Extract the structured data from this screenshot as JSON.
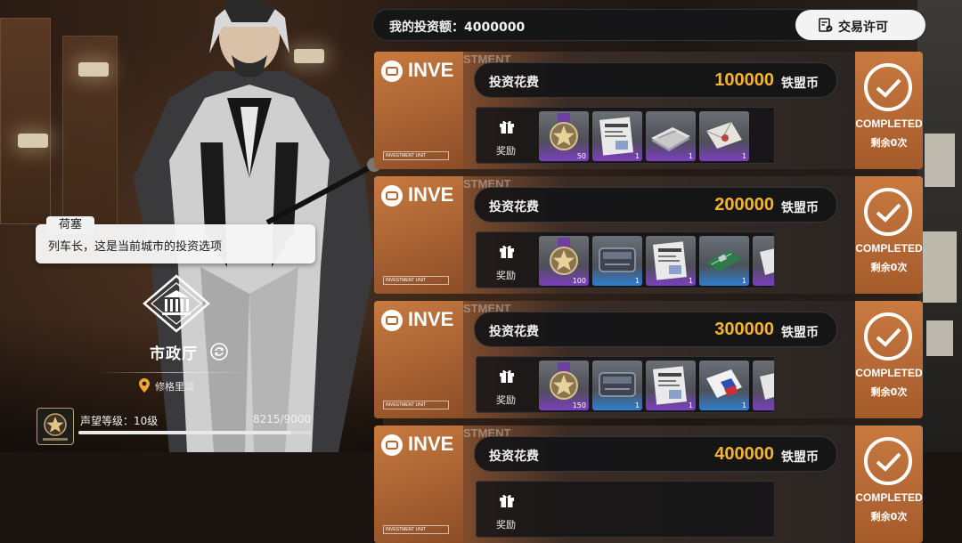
{
  "header": {
    "investment_label": "我的投资额：4000000",
    "license_button": "交易许可"
  },
  "dialogue": {
    "speaker": "荷塞",
    "text": "列车长，这是当前城市的投资选项"
  },
  "building": {
    "name": "市政厅",
    "location": "修格里城"
  },
  "reputation": {
    "label": "声望等级：10级",
    "value": "8215/9000",
    "progress": 0.913
  },
  "card_common": {
    "brand": "INVE",
    "brand_tail": "STMENT",
    "unit_tag": "INVESTMENT UNIT",
    "cost_label": "投资花费",
    "currency": "铁盟币",
    "reward_label": "奖励",
    "status": "COMPLETED",
    "remaining": "剩余0次"
  },
  "cards": [
    {
      "cost": "100000",
      "rewards": [
        {
          "icon": "star-medal-icon",
          "count": "50",
          "rarity": "purple"
        },
        {
          "icon": "document-icon",
          "count": "1",
          "rarity": "purple"
        },
        {
          "icon": "paper-stack-icon",
          "count": "1",
          "rarity": "purple"
        },
        {
          "icon": "envelope-icon",
          "count": "1",
          "rarity": "purple"
        }
      ]
    },
    {
      "cost": "200000",
      "rewards": [
        {
          "icon": "star-medal-icon",
          "count": "100",
          "rarity": "purple"
        },
        {
          "icon": "machine-part-icon",
          "count": "1",
          "rarity": "blue"
        },
        {
          "icon": "document-icon",
          "count": "1",
          "rarity": "purple"
        },
        {
          "icon": "circuit-board-icon",
          "count": "1",
          "rarity": "blue"
        },
        {
          "icon": "paper-icon",
          "count": "",
          "rarity": "purple"
        }
      ]
    },
    {
      "cost": "300000",
      "rewards": [
        {
          "icon": "star-medal-icon",
          "count": "150",
          "rarity": "purple"
        },
        {
          "icon": "machine-part-icon",
          "count": "1",
          "rarity": "blue"
        },
        {
          "icon": "document-icon",
          "count": "1",
          "rarity": "purple"
        },
        {
          "icon": "flag-card-icon",
          "count": "1",
          "rarity": "blue"
        },
        {
          "icon": "paper-icon",
          "count": "",
          "rarity": "purple"
        }
      ]
    },
    {
      "cost": "400000",
      "rewards": []
    }
  ],
  "colors": {
    "accent_orange": "#c87a40",
    "cost_gold": "#f6b42e",
    "rarity_purple": "#7b3fc0",
    "rarity_blue": "#2f7fd0"
  }
}
